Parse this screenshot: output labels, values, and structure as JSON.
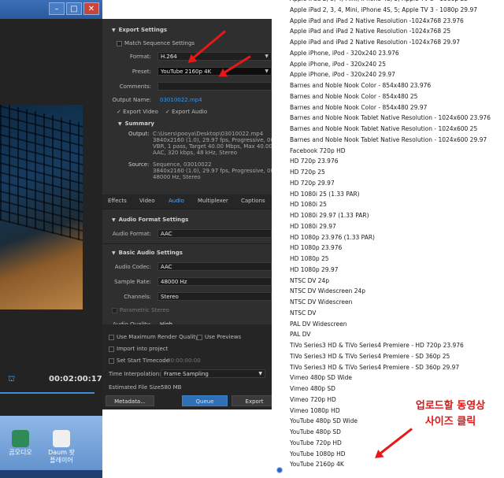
{
  "left_panel": {
    "timecode": "00:02:00:17",
    "desktop_icons": [
      {
        "name": "곰오디오"
      },
      {
        "name": "Daum 팟플레이어"
      }
    ]
  },
  "export_settings": {
    "section_title": "Export Settings",
    "match_sequence_label": "Match Sequence Settings",
    "format_label": "Format:",
    "format_value": "H.264",
    "preset_label": "Preset:",
    "preset_value": "YouTube 2160p 4K",
    "comments_label": "Comments:",
    "output_name_label": "Output Name:",
    "output_name_value": "03010022.mp4",
    "export_video_label": "Export Video",
    "export_audio_label": "Export Audio",
    "summary_title": "Summary",
    "output_label": "Output:",
    "output_lines": [
      "C:\\Users\\pooya\\Desktop\\03010022.mp4",
      "3840x2160 (1.0), 29.97 fps, Progressive, 00:02:0",
      "VBR, 1 pass, Target 40.00 Mbps, Max 40.00 Mbp",
      "AAC, 320 kbps, 48 kHz, Stereo"
    ],
    "source_label": "Source:",
    "source_lines": [
      "Sequence, 03010022",
      "3840x2160 (1.0), 29.97 fps, Progressive, 00:02:0",
      "48000 Hz, Stereo"
    ]
  },
  "tabs": [
    {
      "label": "Effects"
    },
    {
      "label": "Video"
    },
    {
      "label": "Audio"
    },
    {
      "label": "Multiplexer"
    },
    {
      "label": "Captions"
    }
  ],
  "audio": {
    "format_settings_title": "Audio Format Settings",
    "audio_format_label": "Audio Format:",
    "audio_format_value": "AAC",
    "basic_settings_title": "Basic Audio Settings",
    "codec_label": "Audio Codec:",
    "codec_value": "AAC",
    "sample_rate_label": "Sample Rate:",
    "sample_rate_value": "48000 Hz",
    "channels_label": "Channels:",
    "channels_value": "Stereo",
    "parametric_stereo_label": "Parametric Stereo",
    "quality_label": "Audio Quality:",
    "quality_value": "High"
  },
  "bottom": {
    "max_render_label": "Use Maximum Render Quality",
    "use_previews_label": "Use Previews",
    "import_project_label": "Import into project",
    "set_start_label": "Set Start Timecode",
    "start_timecode_value": "00:00:00:00",
    "interpolation_label": "Time Interpolation:",
    "interpolation_value": "Frame Sampling",
    "file_size_label": "Estimated File Size:",
    "file_size_value": "580 MB",
    "metadata_button": "Metadata...",
    "queue_button": "Queue",
    "export_button": "Export"
  },
  "preset_list": [
    "Apple iPad 2, 3, 4, Mini, iPhone 4S, 5; Apple TV 3 - 1080p 25",
    "Apple iPad 2, 3, 4, Mini, iPhone 4S, 5; Apple TV 3 - 1080p 29.97",
    "Apple iPad and iPad 2 Native Resolution -1024x768 23.976",
    "Apple iPad and iPad 2 Native Resolution -1024x768 25",
    "Apple iPad and iPad 2 Native Resolution -1024x768 29.97",
    "Apple iPhone, iPod - 320x240 23.976",
    "Apple iPhone, iPod - 320x240 25",
    "Apple iPhone, iPod - 320x240 29.97",
    "Barnes and Noble Nook Color - 854x480 23.976",
    "Barnes and Noble Nook Color - 854x480 25",
    "Barnes and Noble Nook Color - 854x480 29.97",
    "Barnes and Noble Nook Tablet Native Resolution - 1024x600 23.976",
    "Barnes and Noble Nook Tablet Native Resolution - 1024x600 25",
    "Barnes and Noble Nook Tablet Native Resolution - 1024x600 29.97",
    "Facebook 720p HD",
    "HD 720p 23.976",
    "HD 720p 25",
    "HD 720p 29.97",
    "HD 1080i 25 (1.33 PAR)",
    "HD 1080i 25",
    "HD 1080i 29.97 (1.33 PAR)",
    "HD 1080i 29.97",
    "HD 1080p 23.976 (1.33 PAR)",
    "HD 1080p 23.976",
    "HD 1080p 25",
    "HD 1080p 29.97",
    "NTSC DV 24p",
    "NTSC DV Widescreen 24p",
    "NTSC DV Widescreen",
    "NTSC DV",
    "PAL DV Widescreen",
    "PAL DV",
    "TiVo Series3 HD & TiVo Series4 Premiere - HD 720p 23.976",
    "TiVo Series3 HD & TiVo Series4 Premiere - SD 360p 25",
    "TiVo Series3 HD & TiVo Series4 Premiere - SD 360p 29.97",
    "Vimeo 480p SD Wide",
    "Vimeo 480p SD",
    "Vimeo 720p HD",
    "Vimeo 1080p HD",
    "YouTube 480p SD Wide",
    "YouTube 480p SD",
    "YouTube 720p HD",
    "YouTube 1080p HD",
    "YouTube 2160p 4K"
  ],
  "annotation": {
    "line1": "업로드할 동영상",
    "line2": "사이즈 클릭",
    "color": "#e41313"
  }
}
